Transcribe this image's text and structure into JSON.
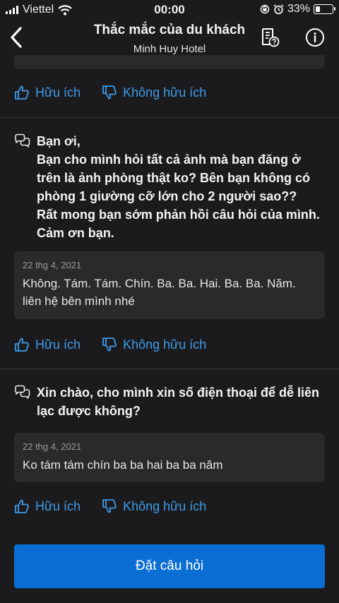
{
  "status_bar": {
    "carrier": "Viettel",
    "time": "00:00",
    "battery": "33%"
  },
  "header": {
    "title": "Thắc mắc của du khách",
    "subtitle": "Minh Huy Hotel"
  },
  "icons": {
    "back": "chevron-left-icon",
    "guidelines": "document-question-icon",
    "info": "info-circle-icon",
    "helpful": "thumbs-up-icon",
    "not_helpful": "thumbs-down-icon",
    "question": "speech-bubbles-icon"
  },
  "colors": {
    "accent": "#3d9be9",
    "button": "#0a6ed4",
    "background": "#1b1b1d",
    "card": "#2a2a2c"
  },
  "feedback": {
    "helpful": "Hữu ích",
    "not_helpful": "Không hữu ích"
  },
  "questions": [
    {
      "text": "Bạn ơi,\nBạn cho mình hỏi tất cả ảnh mà bạn đăng ở trên là ảnh phòng thật ko? Bên bạn không có phòng 1 giường cỡ lớn cho 2 người sao??\nRất mong bạn sớm phản hồi câu hỏi của mình. Cảm ơn bạn.",
      "answer_date": "22 thg 4, 2021",
      "answer_text": "Không. Tám. Tám. Chín. Ba. Ba. Hai. Ba. Ba. Năm.\nliên hệ bên mình nhé"
    },
    {
      "text": "Xin chào, cho mình xin số điện thoại để dễ liên lạc được không?",
      "answer_date": "22 thg 4, 2021",
      "answer_text": "Ko tám tám chín ba ba hai ba ba năm"
    }
  ],
  "ask_button": "Đặt câu hỏi"
}
